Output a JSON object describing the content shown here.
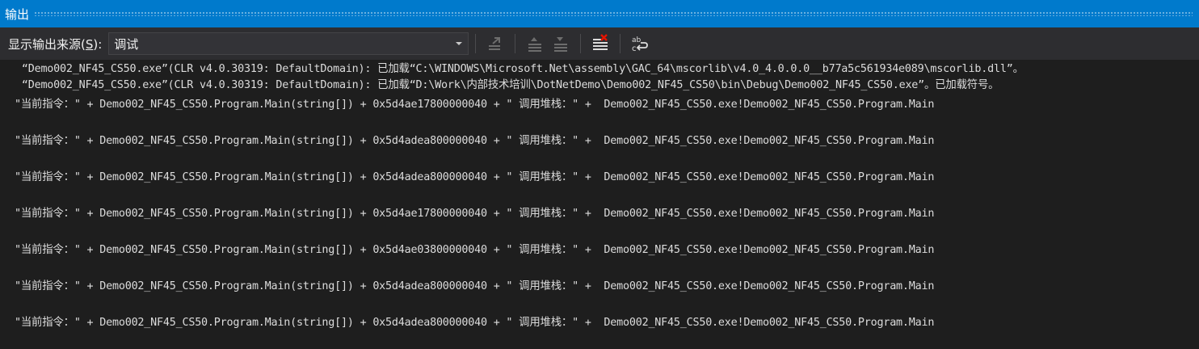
{
  "panel": {
    "title": "输出"
  },
  "toolbar": {
    "source_label_prefix": "显示输出来源(",
    "source_label_accel": "S",
    "source_label_suffix": "):",
    "source_value": "调试",
    "buttons": [
      {
        "name": "find-message-in-code-button",
        "icon": "goto-code-icon"
      },
      {
        "name": "previous-message-button",
        "icon": "prev-message-icon"
      },
      {
        "name": "next-message-button",
        "icon": "next-message-icon"
      },
      {
        "name": "clear-all-button",
        "icon": "clear-all-icon"
      },
      {
        "name": "toggle-word-wrap-button",
        "icon": "word-wrap-icon"
      }
    ]
  },
  "output_lines": [
    " “Demo002_NF45_CS50.exe”(CLR v4.0.30319: DefaultDomain): 已加载“C:\\WINDOWS\\Microsoft.Net\\assembly\\GAC_64\\mscorlib\\v4.0_4.0.0.0__b77a5c561934e089\\mscorlib.dll”。",
    " “Demo002_NF45_CS50.exe”(CLR v4.0.30319: DefaultDomain): 已加载“D:\\Work\\内部技术培训\\DotNetDemo\\Demo002_NF45_CS50\\bin\\Debug\\Demo002_NF45_CS50.exe”。已加载符号。",
    "\"当前指令：\" + Demo002_NF45_CS50.Program.Main(string[]) + 0x5d4ae17800000040 + \" 调用堆栈：\" +  Demo002_NF45_CS50.exe!Demo002_NF45_CS50.Program.Main",
    "",
    "\"当前指令：\" + Demo002_NF45_CS50.Program.Main(string[]) + 0x5d4adea800000040 + \" 调用堆栈：\" +  Demo002_NF45_CS50.exe!Demo002_NF45_CS50.Program.Main",
    "",
    "\"当前指令：\" + Demo002_NF45_CS50.Program.Main(string[]) + 0x5d4adea800000040 + \" 调用堆栈：\" +  Demo002_NF45_CS50.exe!Demo002_NF45_CS50.Program.Main",
    "",
    "\"当前指令：\" + Demo002_NF45_CS50.Program.Main(string[]) + 0x5d4ae17800000040 + \" 调用堆栈：\" +  Demo002_NF45_CS50.exe!Demo002_NF45_CS50.Program.Main",
    "",
    "\"当前指令：\" + Demo002_NF45_CS50.Program.Main(string[]) + 0x5d4ae03800000040 + \" 调用堆栈：\" +  Demo002_NF45_CS50.exe!Demo002_NF45_CS50.Program.Main",
    "",
    "\"当前指令：\" + Demo002_NF45_CS50.Program.Main(string[]) + 0x5d4adea800000040 + \" 调用堆栈：\" +  Demo002_NF45_CS50.exe!Demo002_NF45_CS50.Program.Main",
    "",
    "\"当前指令：\" + Demo002_NF45_CS50.Program.Main(string[]) + 0x5d4adea800000040 + \" 调用堆栈：\" +  Demo002_NF45_CS50.exe!Demo002_NF45_CS50.Program.Main"
  ],
  "colors": {
    "title_bar": "#007acc",
    "toolbar_bg": "#2d2d30",
    "editor_bg": "#1e1e1e",
    "text": "#dcdcdc"
  }
}
